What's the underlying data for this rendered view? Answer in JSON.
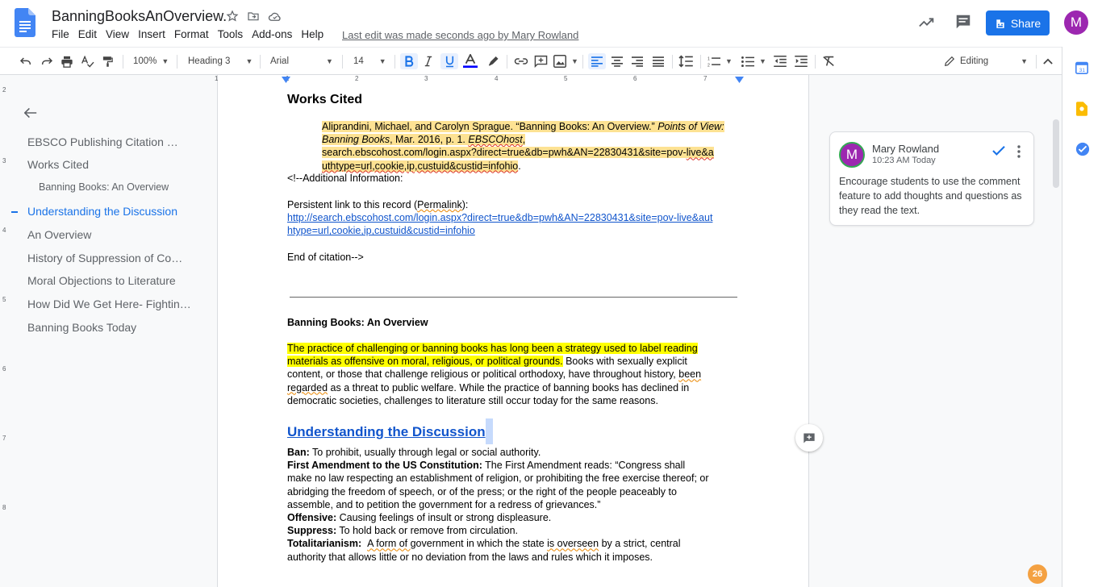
{
  "doc_title": "BanningBooksAnOverview.",
  "menu": [
    "File",
    "Edit",
    "View",
    "Insert",
    "Format",
    "Tools",
    "Add-ons",
    "Help"
  ],
  "last_edit": "Last edit was made seconds ago by Mary Rowland",
  "share_label": "Share",
  "avatar_letter": "M",
  "toolbar": {
    "zoom": "100%",
    "style": "Heading 3",
    "font": "Arial",
    "size": "14",
    "mode": "Editing"
  },
  "ruler": [
    "1",
    "1",
    "2",
    "3",
    "4",
    "5",
    "6",
    "7"
  ],
  "vruler": [
    "2",
    "3",
    "4",
    "5",
    "6",
    "7",
    "8"
  ],
  "outline": [
    {
      "label": "EBSCO Publishing    Citation …",
      "level": "h1"
    },
    {
      "label": "Works Cited",
      "level": "h1"
    },
    {
      "label": "Banning Books: An Overview",
      "level": "h3"
    },
    {
      "label": "Understanding the Discussion",
      "level": "h1",
      "selected": true
    },
    {
      "label": "An Overview",
      "level": "h1"
    },
    {
      "label": "History of Suppression of Co…",
      "level": "h1"
    },
    {
      "label": "Moral Objections to Literature",
      "level": "h1"
    },
    {
      "label": "How Did We Get Here- Fightin…",
      "level": "h1"
    },
    {
      "label": "Banning Books Today",
      "level": "h1"
    }
  ],
  "doc": {
    "works_cited": "Works Cited",
    "cite_a": "Aliprandini, Michael, and Carolyn Sprague. “Banning Books: An Overview.” ",
    "cite_b": "Points of View: Banning Books",
    "cite_c": ", Mar. 2016, p. 1. ",
    "cite_d": "EBSCOhost",
    "cite_e": ",",
    "cite_url1": "search.ebscohost.com/login.aspx?direct=true&db=pwh&AN=22830431&site=pov-",
    "cite_url2": "live&a",
    "cite_url3": "uthtype=url,cookie,ip,custuid&custid=infohio",
    "cite_end": ".",
    "addl": "<!--Additional Information:",
    "persist_a": "Persistent link to this record (",
    "persist_b": "Permalink",
    "persist_c": "):",
    "link1": "http://search.ebscohost.com/login.aspx?direct=true&db=pwh&AN=22830431&site=pov-live&aut",
    "link2": "htype=url,cookie,ip,custuid&custid=infohio",
    "end_cit": "End of citation-->",
    "overview_title": "Banning Books: An Overview",
    "p1_hl1": "The practice of challenging or banning books has long been a strategy used to label reading",
    "p1_hl2": "materials as offensive on moral, religious, or political grounds.",
    "p1_a": " Books with sexually explicit",
    "p1_b": "content, or those that challenge religious or political orthodoxy, have throughout history, ",
    "p1_c": "been",
    "p1_d": "regarded",
    "p1_e": " as a threat to public welfare. While the practice of banning books has declined in",
    "p1_f": "democratic societies, challenges to literature still occur today for the same reasons.",
    "h_understand": "Understanding the Discussion",
    "ban_t": "Ban:",
    "ban_d": "  To prohibit, usually through legal or social authority.",
    "fa_t": "First Amendment to the US Constitution:",
    "fa_d1": "  The First Amendment reads: “Congress shall",
    "fa_d2": "make no law respecting an establishment of religion, or prohibiting the free exercise thereof; or",
    "fa_d3": "abridging the freedom of speech, or of the press; or the right of the people peaceably to",
    "fa_d4": "assemble, and to petition the government for a redress of grievances.”",
    "off_t": "Offensive:",
    "off_d": "  Causing feelings of insult or strong displeasure.",
    "sup_t": "Suppress:",
    "sup_d": "  To hold back or remove from circulation.",
    "tot_t": "Totalitarianism:",
    "tot_a": "A form of ",
    "tot_b": "government in which the state ",
    "tot_c": "is overseen",
    "tot_d": " by a strict, central",
    "tot_e": "authority that allows little or no deviation from the laws and rules which it imposes."
  },
  "comment": {
    "author": "Mary Rowland",
    "time": "10:23 AM Today",
    "avatar": "M",
    "text": "Encourage students to use the comment feature to add thoughts and questions as they read the text."
  },
  "notif_count": "26",
  "colors": {
    "accent": "#1a73e8",
    "highlight": "#fde293",
    "yellow": "#ffff00",
    "avatar": "#9c27b0"
  }
}
